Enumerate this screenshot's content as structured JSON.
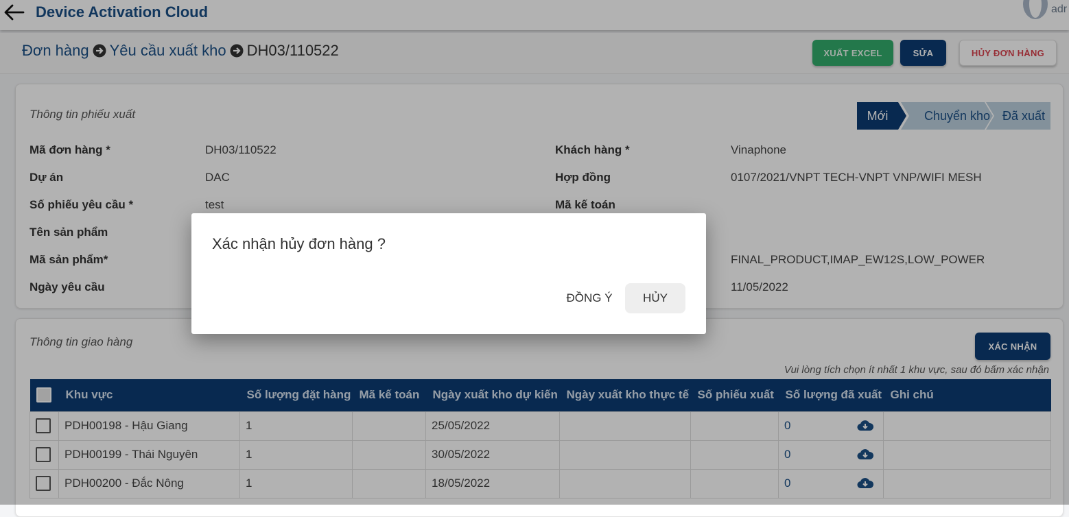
{
  "app": {
    "title": "Device Activation Cloud",
    "user": "adr"
  },
  "breadcrumb": {
    "level1": "Đơn hàng",
    "level2": "Yêu cầu xuất kho",
    "current": "DH03/110522"
  },
  "toolbar": {
    "export_label": "XUẤT EXCEL",
    "edit_label": "SỬA",
    "cancel_order_label": "HỦY ĐƠN HÀNG"
  },
  "colors": {
    "primary": "#0c3b73",
    "brand_text": "#1b4f86",
    "success": "#33ad6c",
    "danger": "#d8434e"
  },
  "slip": {
    "section_title": "Thông tin phiếu xuất",
    "steps": [
      {
        "label": "Mới",
        "active": true
      },
      {
        "label": "Chuyển kho",
        "active": false
      },
      {
        "label": "Đã xuất",
        "active": false
      }
    ],
    "fields_left": [
      {
        "label": "Mã đơn hàng *",
        "value": "DH03/110522"
      },
      {
        "label": "Dự án",
        "value": "DAC"
      },
      {
        "label": "Số phiếu yêu cầu *",
        "value": "test"
      },
      {
        "label": "Tên sản phẩm",
        "value": ""
      },
      {
        "label": "Mã sản phẩm*",
        "value": ""
      },
      {
        "label": "Ngày yêu cầu",
        "value": ""
      }
    ],
    "fields_right": [
      {
        "label": "Khách hàng *",
        "value": "Vinaphone"
      },
      {
        "label": "Hợp đồng",
        "value": "0107/2021/VNPT TECH-VNPT VNP/WIFI MESH"
      },
      {
        "label": "Mã kế toán",
        "value": ""
      },
      {
        "label": "",
        "value": ""
      },
      {
        "label": "",
        "value": "FINAL_PRODUCT,IMAP_EW12S,LOW_POWER"
      },
      {
        "label": "",
        "value": "11/05/2022"
      }
    ]
  },
  "delivery": {
    "section_title": "Thông tin giao hàng",
    "confirm_label": "XÁC NHẬN",
    "hint": "Vui lòng tích chọn ít nhất 1 khu vực, sau đó bấm xác nhận",
    "columns": [
      "Khu vực",
      "Số lượng đặt hàng",
      "Mã kế toán",
      "Ngày xuất kho dự kiến",
      "Ngày xuất kho thực tế",
      "Số phiếu xuất",
      "Số lượng đã xuất",
      "Ghi chú"
    ],
    "rows": [
      {
        "area": "PDH00198 - Hậu Giang",
        "qty": "1",
        "acct": "",
        "planned": "25/05/2022",
        "actual": "",
        "slip_no": "",
        "exported": "0",
        "note": "",
        "icon": "cloud-download-icon"
      },
      {
        "area": "PDH00199 - Thái Nguyên",
        "qty": "1",
        "acct": "",
        "planned": "30/05/2022",
        "actual": "",
        "slip_no": "",
        "exported": "0",
        "note": "",
        "icon": "cloud-download-icon"
      },
      {
        "area": "PDH00200 - Đắc Nông",
        "qty": "1",
        "acct": "",
        "planned": "18/05/2022",
        "actual": "",
        "slip_no": "",
        "exported": "0",
        "note": "",
        "icon": "cloud-download-icon"
      }
    ]
  },
  "dialog": {
    "message": "Xác nhận hủy đơn hàng ?",
    "agree_label": "ĐỒNG Ý",
    "cancel_label": "HỦY"
  }
}
